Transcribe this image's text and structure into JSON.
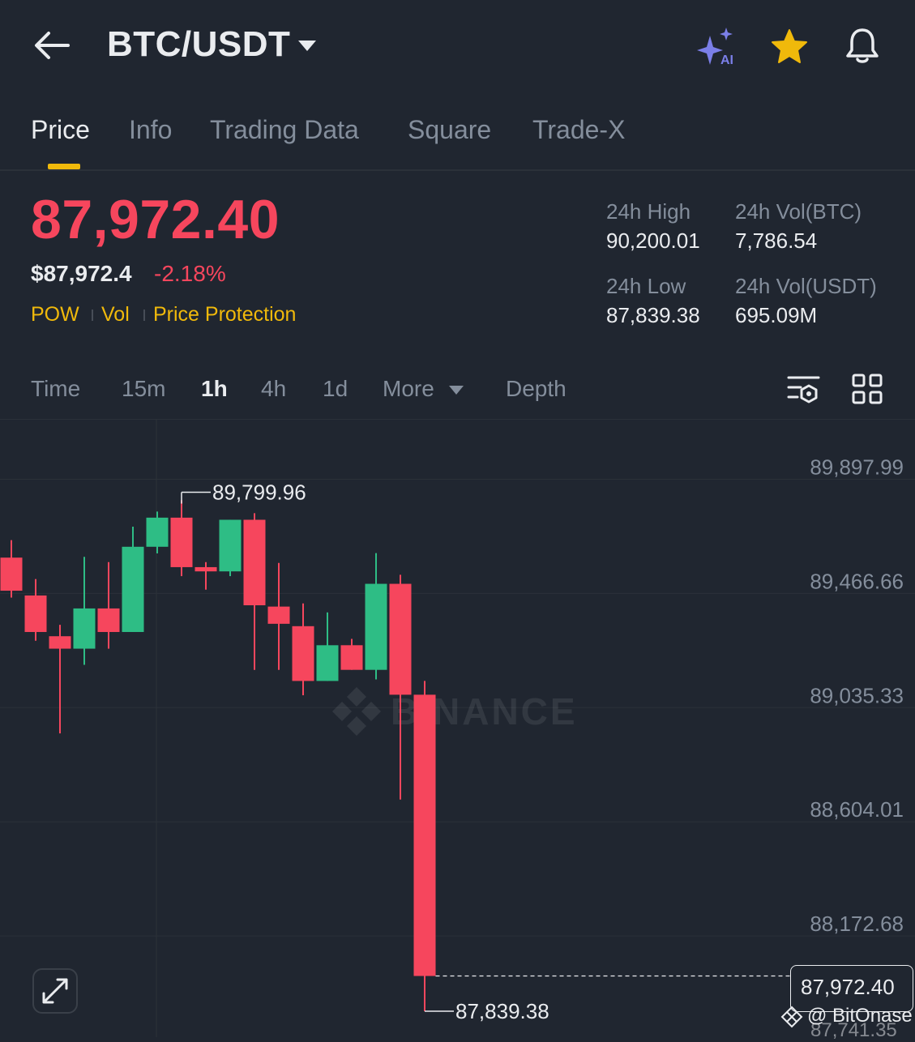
{
  "header": {
    "pair": "BTC/USDT",
    "icons": [
      "back-arrow-icon",
      "ai-sparkle-icon",
      "star-icon",
      "bell-icon"
    ],
    "ai_badge": "AI"
  },
  "tabs": [
    "Price",
    "Info",
    "Trading Data",
    "Square",
    "Trade-X"
  ],
  "price": {
    "last": "87,972.40",
    "usd": "$87,972.4",
    "change": "-2.18%",
    "tags": [
      "POW",
      "Vol",
      "Price Protection"
    ]
  },
  "stats": {
    "high_label": "24h High",
    "high_value": "90,200.01",
    "low_label": "24h Low",
    "low_value": "87,839.38",
    "vol_btc_label": "24h Vol(BTC)",
    "vol_btc_value": "7,786.54",
    "vol_usdt_label": "24h Vol(USDT)",
    "vol_usdt_value": "695.09M"
  },
  "intervals": [
    "Time",
    "15m",
    "1h",
    "4h",
    "1d",
    "More",
    "Depth"
  ],
  "active_interval": "1h",
  "colors": {
    "up": "#2ebd85",
    "down": "#f6465d",
    "accent": "#f0b90b",
    "bg": "#202630"
  },
  "chart_data": {
    "type": "candlestick",
    "y_ticks": [
      "89,897.99",
      "89,466.66",
      "89,035.33",
      "88,604.01",
      "88,172.68"
    ],
    "y_tick_values": [
      89897.99,
      89466.66,
      89035.33,
      88604.01,
      88172.68
    ],
    "ylim": [
      87741.35,
      90074.0
    ],
    "grid": true,
    "watermark": "BINANCE",
    "high_marker": "89,799.96",
    "low_marker": "87,839.38",
    "current_price": "87,972.40",
    "candles": [
      {
        "open": 89553,
        "close": 89428,
        "high": 89619,
        "low": 89402
      },
      {
        "open": 89410,
        "close": 89272,
        "high": 89472,
        "low": 89239
      },
      {
        "open": 89256,
        "close": 89209,
        "high": 89299,
        "low": 88889
      },
      {
        "open": 89209,
        "close": 89361,
        "high": 89556,
        "low": 89148
      },
      {
        "open": 89361,
        "close": 89272,
        "high": 89536,
        "low": 89209
      },
      {
        "open": 89272,
        "close": 89594,
        "high": 89670,
        "low": 89272
      },
      {
        "open": 89594,
        "close": 89704,
        "high": 89727,
        "low": 89569
      },
      {
        "open": 89704,
        "close": 89517,
        "high": 89770,
        "low": 89483
      },
      {
        "open": 89517,
        "close": 89501,
        "high": 89536,
        "low": 89432
      },
      {
        "open": 89501,
        "close": 89696,
        "high": 89696,
        "low": 89483
      },
      {
        "open": 89696,
        "close": 89373,
        "high": 89721,
        "low": 89129
      },
      {
        "open": 89368,
        "close": 89303,
        "high": 89533,
        "low": 89129
      },
      {
        "open": 89294,
        "close": 89087,
        "high": 89380,
        "low": 89033
      },
      {
        "open": 89087,
        "close": 89222,
        "high": 89346,
        "low": 89087
      },
      {
        "open": 89222,
        "close": 89129,
        "high": 89246,
        "low": 89129
      },
      {
        "open": 89129,
        "close": 89454,
        "high": 89570,
        "low": 89093
      },
      {
        "open": 89454,
        "close": 89035,
        "high": 89488,
        "low": 88639
      },
      {
        "open": 89035,
        "close": 87972.4,
        "high": 89087,
        "low": 87839.38
      }
    ]
  },
  "watermark_user": "@ BitOnase",
  "partial_label": "87,741.35"
}
